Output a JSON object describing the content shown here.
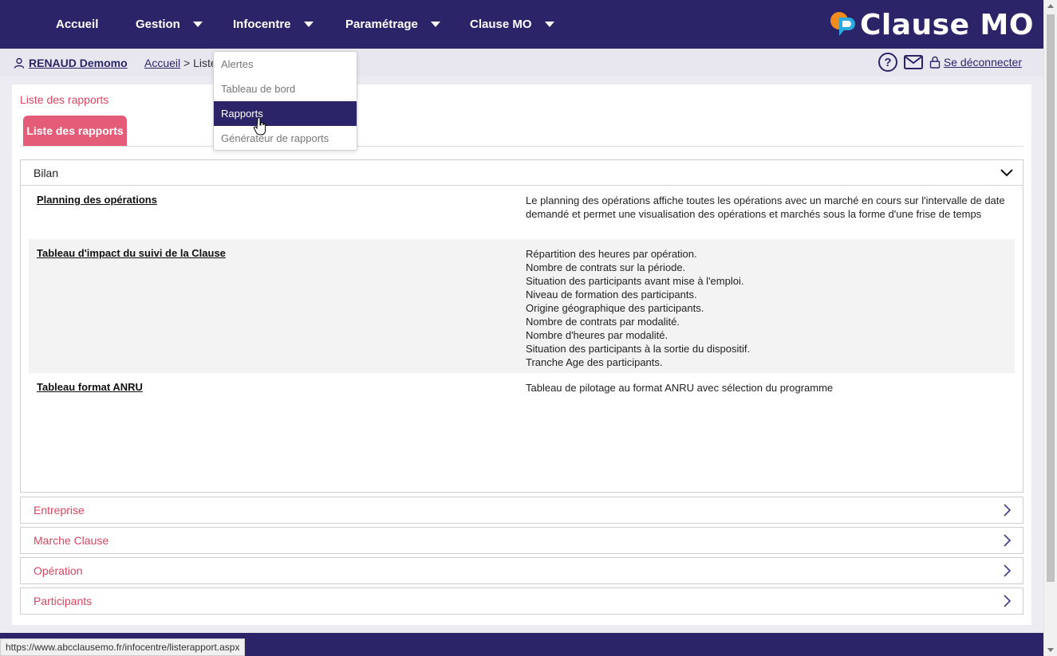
{
  "nav": {
    "items": [
      {
        "label": "Accueil",
        "has_menu": false
      },
      {
        "label": "Gestion",
        "has_menu": true
      },
      {
        "label": "Infocentre",
        "has_menu": true
      },
      {
        "label": "Paramétrage",
        "has_menu": true
      },
      {
        "label": "Clause MO",
        "has_menu": true
      }
    ],
    "brand": "Clause MO"
  },
  "dropdown": {
    "items": [
      "Alertes",
      "Tableau de bord",
      "Rapports",
      "Générateur de rapports"
    ],
    "active": "Rapports"
  },
  "subbar": {
    "user": "RENAUD Demomo",
    "breadcrumb_home": "Accueil",
    "breadcrumb_sep": " > Liste",
    "help": "?",
    "logout": "Se déconnecter"
  },
  "page": {
    "title": "Liste des rapports",
    "tab": "Liste des rapports"
  },
  "sections": {
    "open": {
      "title": "Bilan",
      "reports": [
        {
          "name": "Planning des opérations",
          "description": "Le planning des opérations affiche toutes les opérations avec un marché en cours sur l'intervalle de date demandé et permet une visualisation des opérations et marchés sous la forme d'une frise de temps"
        },
        {
          "name": "Tableau d'impact du suivi de la Clause",
          "description_lines": [
            "Répartition des heures par opération.",
            "Nombre de contrats sur la période.",
            "Situation des participants avant mise à l'emploi.",
            "Niveau de formation des participants.",
            "Origine géographique des participants.",
            "Nombre de contrats par modalité.",
            "Nombre d'heures par modalité.",
            "Situation des participants à la sortie du dispositif.",
            "Tranche Age des participants."
          ]
        },
        {
          "name": "Tableau format ANRU",
          "description": "Tableau de pilotage au format ANRU avec sélection du programme"
        }
      ]
    },
    "closed": [
      "Entreprise",
      "Marche Clause",
      "Opération",
      "Participants"
    ]
  },
  "status_url": "https://www.abcclausemo.fr/infocentre/listerapport.aspx",
  "colors": {
    "nav_bg": "#2c2468",
    "accent": "#e55c78",
    "section_title": "#d9465f"
  }
}
